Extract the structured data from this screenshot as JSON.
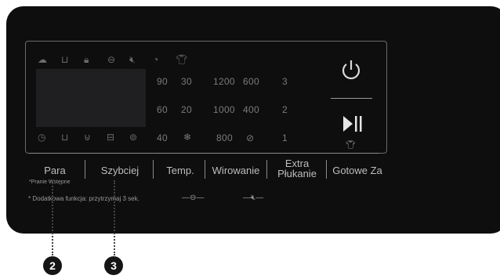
{
  "buttons": {
    "para": "Para",
    "para_sub": "*Pranie Wstępne",
    "szybciej": "Szybciej",
    "temp": "Temp.",
    "wirowanie": "Wirowanie",
    "extra_line1": "Extra",
    "extra_line2": "Płukanie",
    "gotowe": "Gotowe Za"
  },
  "note": "* Dodatkowa funkcja: przytrzymaj 3 sek.",
  "display": {
    "temp_values": [
      "90",
      "60",
      "40"
    ],
    "temp_values_b": [
      "30",
      "20"
    ],
    "spin_values": [
      "1200",
      "1000",
      "800"
    ],
    "spin_values_b": [
      "600",
      "400"
    ],
    "rinse_values": [
      "3",
      "2",
      "1"
    ]
  },
  "icons": {
    "top_row": [
      "steam-icon",
      "tub-icon",
      "lock-icon",
      "drum-icon",
      "mute-icon",
      "dry-icon",
      "shirt-icon"
    ],
    "bottom_row": [
      "clock-icon",
      "tub-icon",
      "tub-double-icon",
      "tray-icon",
      "drum-clean-icon"
    ],
    "snowflake": "snowflake-icon",
    "no_spin": "no-spin-icon",
    "power": "power-icon",
    "play_pause": "play-pause-icon",
    "shirt_small": "shirt-icon"
  },
  "callouts": [
    "2",
    "3"
  ]
}
